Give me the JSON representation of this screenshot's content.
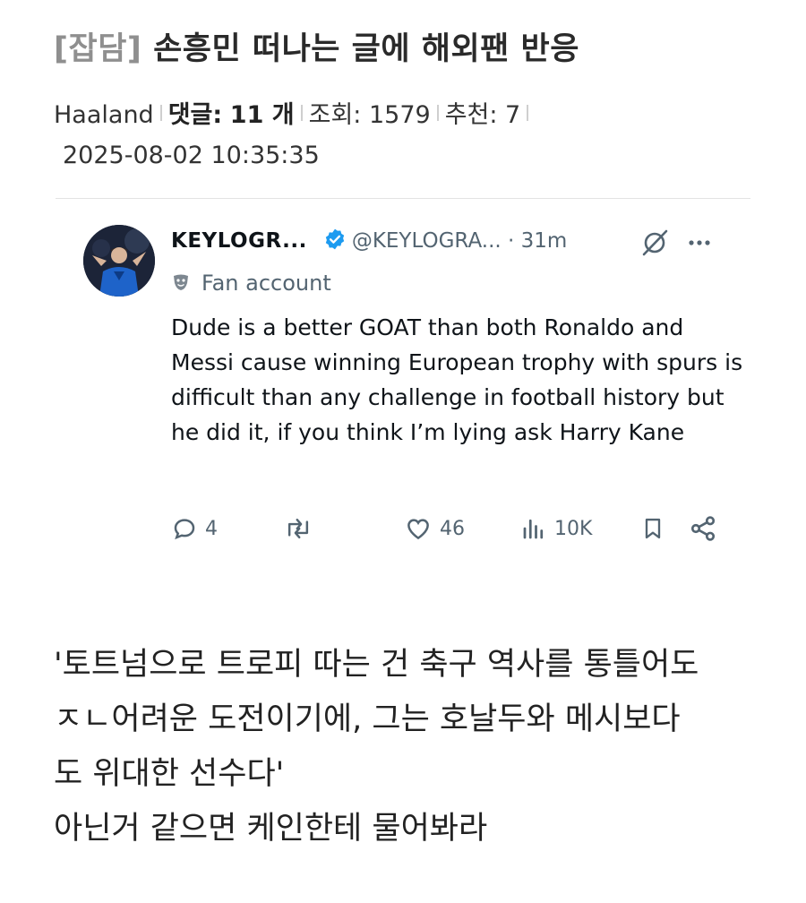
{
  "post": {
    "category": "[잡담]",
    "title": " 손흥민 떠나는 글에 해외팬 반응",
    "author": "Haaland",
    "comments_label": "댓글:",
    "comments_count": "11 개",
    "views": "조회: 1579",
    "likes": "추천: 7",
    "date": "2025-08-02 10:35:35"
  },
  "tweet": {
    "display_name": "KEYLOGR...",
    "handle": "@KEYLOGRA...",
    "time": " · 31m",
    "subtitle": "Fan account",
    "text": "Dude is a better GOAT than both Ronaldo and Messi cause winning European trophy with spurs is difficult than any challenge in football history but he did it, if you think I’m lying ask Harry Kane",
    "replies": "4",
    "likes": "46",
    "views": "10K",
    "icons": [
      "verified-badge-icon",
      "grok-icon",
      "more-icon",
      "reply-icon",
      "retweet-icon",
      "like-icon",
      "views-icon",
      "bookmark-icon",
      "share-icon",
      "fan-account-mask-icon"
    ]
  },
  "caption": {
    "line1": "'토트넘으로 트로피 따는 건 축구 역사를 통틀어도",
    "line2": "ㅈㄴ어려운 도전이기에, 그는 호날두와 메시보다",
    "line3": "도 위대한 선수다'",
    "line4": "아닌거 같으면 케인한테 물어봐라"
  },
  "colors": {
    "verified": "#1d9bf0",
    "muted": "#536471",
    "category": "#8f8f8f"
  }
}
